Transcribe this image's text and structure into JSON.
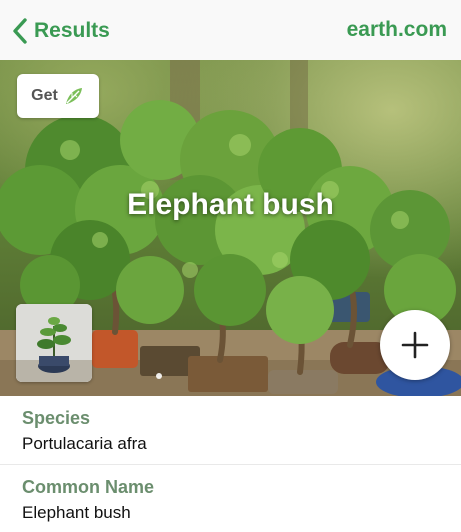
{
  "header": {
    "back_label": "Results",
    "brand": "earth.com",
    "accent": "#3a9a53"
  },
  "hero": {
    "title": "Elephant bush",
    "get_label": "Get",
    "get_icon": "leaf-icon",
    "add_icon": "plus-icon",
    "thumbnail": "plant-thumbnail"
  },
  "details": [
    {
      "label": "Species",
      "value": "Portulacaria afra"
    },
    {
      "label": "Common Name",
      "value": "Elephant bush"
    }
  ]
}
